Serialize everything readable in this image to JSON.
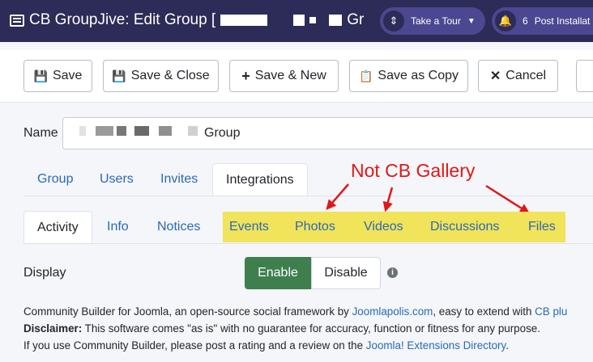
{
  "header": {
    "title_prefix": "CB GroupJive: Edit Group [",
    "title_tail": "Gr",
    "tour_label": "Take a Tour",
    "notification_count": "6",
    "post_install_label": "Post Installat"
  },
  "toolbar": {
    "save": "Save",
    "save_close": "Save & Close",
    "save_new": "Save & New",
    "save_copy": "Save as Copy",
    "cancel": "Cancel"
  },
  "form": {
    "name_label": "Name",
    "name_value": "Group"
  },
  "tabs_primary": [
    "Group",
    "Users",
    "Invites",
    "Integrations"
  ],
  "tabs_secondary": [
    "Activity",
    "Info",
    "Notices",
    "Events",
    "Photos",
    "Videos",
    "Discussions",
    "Files"
  ],
  "annotation": "Not CB Gallery",
  "display": {
    "label": "Display",
    "enable": "Enable",
    "disable": "Disable"
  },
  "footer": {
    "line1_text": "Community Builder for Joomla, an open-source social framework by ",
    "line1_link1": "Joomlapolis.com",
    "line1_mid": ", easy to extend with ",
    "line1_link2": "CB plu",
    "disclaimer_label": "Disclaimer:",
    "disclaimer_text": " This software comes \"as is\" with no guarantee for accuracy, function or fitness for any purpose.",
    "line3_text": "If you use Community Builder, please post a rating and a review on the ",
    "line3_link": "Joomla! Extensions Directory",
    "line3_end": "."
  },
  "colors": {
    "header_bg": "#2d2b57",
    "enable_green": "#3f7f4e",
    "highlight_yellow": "#f1e35a",
    "annotation_red": "#e11717",
    "link_blue": "#2a69b8"
  }
}
